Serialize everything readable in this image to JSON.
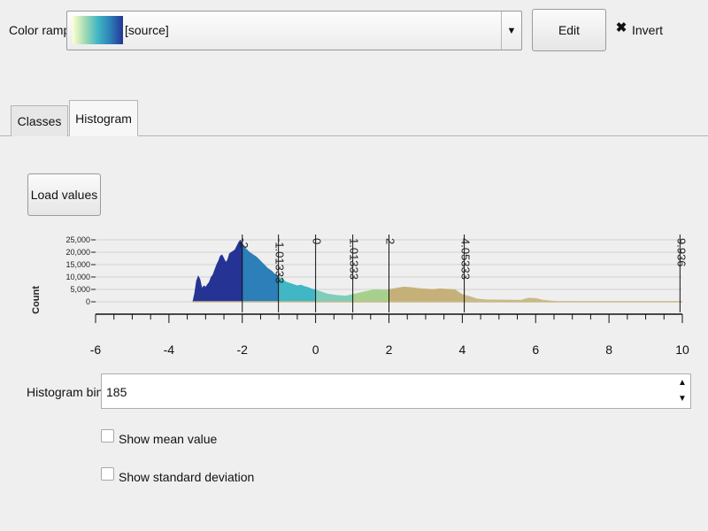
{
  "color_ramp": {
    "label": "Color ramp",
    "value": "[source]",
    "edit_label": "Edit",
    "invert_label": "Invert",
    "invert_checked": true
  },
  "tabs": [
    {
      "label": "Classes",
      "active": false
    },
    {
      "label": "Histogram",
      "active": true
    }
  ],
  "load_values_label": "Load values",
  "chart_data": {
    "type": "area",
    "ylabel": "Count",
    "y_ticks": [
      "25,000",
      "20,000",
      "15,000",
      "10,000",
      "5,000",
      "0"
    ],
    "ylim": [
      0,
      25000
    ],
    "xlim": [
      -6,
      10
    ],
    "x_ticks": [
      "-6",
      "-4",
      "-2",
      "0",
      "2",
      "4",
      "6",
      "8",
      "10"
    ],
    "class_breaks": [
      {
        "value": -2,
        "label": "-2"
      },
      {
        "value": -1.01333,
        "label": "-1.01333"
      },
      {
        "value": 0,
        "label": "0"
      },
      {
        "value": 1.01333,
        "label": "1.01333"
      },
      {
        "value": 2,
        "label": "2"
      },
      {
        "value": 4.05333,
        "label": "4.05333"
      },
      {
        "value": 9.936,
        "label": "9.936"
      }
    ],
    "series": [
      {
        "x": -3.35,
        "y": 0
      },
      {
        "x": -3.3,
        "y": 3500
      },
      {
        "x": -3.25,
        "y": 8500
      },
      {
        "x": -3.2,
        "y": 10500
      },
      {
        "x": -3.15,
        "y": 9000
      },
      {
        "x": -3.1,
        "y": 5500
      },
      {
        "x": -3.05,
        "y": 6500
      },
      {
        "x": -3.0,
        "y": 6000
      },
      {
        "x": -2.95,
        "y": 7000
      },
      {
        "x": -2.9,
        "y": 8000
      },
      {
        "x": -2.85,
        "y": 10000
      },
      {
        "x": -2.8,
        "y": 11000
      },
      {
        "x": -2.75,
        "y": 13000
      },
      {
        "x": -2.7,
        "y": 15000
      },
      {
        "x": -2.65,
        "y": 16500
      },
      {
        "x": -2.6,
        "y": 18500
      },
      {
        "x": -2.55,
        "y": 19000
      },
      {
        "x": -2.5,
        "y": 17500
      },
      {
        "x": -2.45,
        "y": 16000
      },
      {
        "x": -2.4,
        "y": 17000
      },
      {
        "x": -2.35,
        "y": 19500
      },
      {
        "x": -2.3,
        "y": 20000
      },
      {
        "x": -2.25,
        "y": 20500
      },
      {
        "x": -2.2,
        "y": 21000
      },
      {
        "x": -2.15,
        "y": 22500
      },
      {
        "x": -2.1,
        "y": 24000
      },
      {
        "x": -2.05,
        "y": 25000
      },
      {
        "x": -2.0,
        "y": 23500
      },
      {
        "x": -1.9,
        "y": 21500
      },
      {
        "x": -1.8,
        "y": 20000
      },
      {
        "x": -1.7,
        "y": 19000
      },
      {
        "x": -1.6,
        "y": 18000
      },
      {
        "x": -1.5,
        "y": 16500
      },
      {
        "x": -1.4,
        "y": 15000
      },
      {
        "x": -1.3,
        "y": 13500
      },
      {
        "x": -1.2,
        "y": 12500
      },
      {
        "x": -1.1,
        "y": 11000
      },
      {
        "x": -1.0,
        "y": 10000
      },
      {
        "x": -0.9,
        "y": 9000
      },
      {
        "x": -0.8,
        "y": 8000
      },
      {
        "x": -0.7,
        "y": 7500
      },
      {
        "x": -0.6,
        "y": 7000
      },
      {
        "x": -0.5,
        "y": 6500
      },
      {
        "x": -0.4,
        "y": 6800
      },
      {
        "x": -0.3,
        "y": 6200
      },
      {
        "x": -0.2,
        "y": 5800
      },
      {
        "x": -0.1,
        "y": 5200
      },
      {
        "x": 0.0,
        "y": 4800
      },
      {
        "x": 0.1,
        "y": 4300
      },
      {
        "x": 0.2,
        "y": 3800
      },
      {
        "x": 0.3,
        "y": 3300
      },
      {
        "x": 0.4,
        "y": 3000
      },
      {
        "x": 0.5,
        "y": 2800
      },
      {
        "x": 0.6,
        "y": 2600
      },
      {
        "x": 0.7,
        "y": 2500
      },
      {
        "x": 0.8,
        "y": 2400
      },
      {
        "x": 0.9,
        "y": 2600
      },
      {
        "x": 1.0,
        "y": 3000
      },
      {
        "x": 1.1,
        "y": 3300
      },
      {
        "x": 1.2,
        "y": 3600
      },
      {
        "x": 1.3,
        "y": 4000
      },
      {
        "x": 1.4,
        "y": 4300
      },
      {
        "x": 1.5,
        "y": 4600
      },
      {
        "x": 1.6,
        "y": 4900
      },
      {
        "x": 1.7,
        "y": 4900
      },
      {
        "x": 1.8,
        "y": 4800
      },
      {
        "x": 1.9,
        "y": 4700
      },
      {
        "x": 2.0,
        "y": 5000
      },
      {
        "x": 2.2,
        "y": 5500
      },
      {
        "x": 2.4,
        "y": 6000
      },
      {
        "x": 2.6,
        "y": 5800
      },
      {
        "x": 2.8,
        "y": 5400
      },
      {
        "x": 3.0,
        "y": 5200
      },
      {
        "x": 3.2,
        "y": 5000
      },
      {
        "x": 3.4,
        "y": 5300
      },
      {
        "x": 3.6,
        "y": 5100
      },
      {
        "x": 3.8,
        "y": 4900
      },
      {
        "x": 4.0,
        "y": 3000
      },
      {
        "x": 4.2,
        "y": 2200
      },
      {
        "x": 4.4,
        "y": 1200
      },
      {
        "x": 4.6,
        "y": 900
      },
      {
        "x": 4.8,
        "y": 800
      },
      {
        "x": 5.0,
        "y": 800
      },
      {
        "x": 5.2,
        "y": 750
      },
      {
        "x": 5.4,
        "y": 700
      },
      {
        "x": 5.6,
        "y": 700
      },
      {
        "x": 5.8,
        "y": 1500
      },
      {
        "x": 6.0,
        "y": 1400
      },
      {
        "x": 6.2,
        "y": 700
      },
      {
        "x": 6.4,
        "y": 400
      },
      {
        "x": 6.6,
        "y": 150
      },
      {
        "x": 7.0,
        "y": 100
      },
      {
        "x": 8.0,
        "y": 60
      },
      {
        "x": 9.0,
        "y": 40
      },
      {
        "x": 9.936,
        "y": 30
      }
    ],
    "class_colors": [
      "#253494",
      "#2c7fb8",
      "#41b6c4",
      "#7fcdbb",
      "#a8d08d",
      "#c6b07a",
      "#c9b98a"
    ]
  },
  "histogram_bins": {
    "label": "Histogram bins",
    "value": "185"
  },
  "show_mean": {
    "label": "Show mean value",
    "checked": false
  },
  "show_std": {
    "label": "Show standard deviation",
    "checked": false
  }
}
